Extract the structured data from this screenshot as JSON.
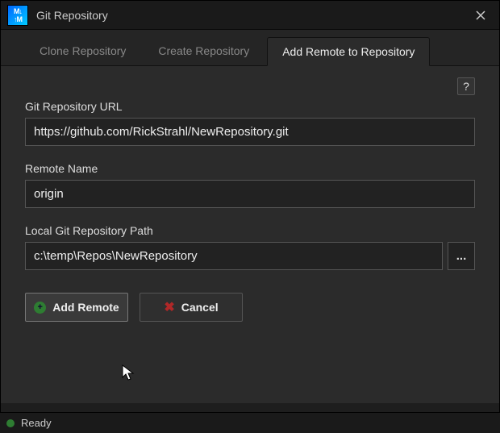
{
  "window": {
    "title": "Git Repository"
  },
  "tabs": {
    "clone": "Clone Repository",
    "create": "Create Repository",
    "addremote": "Add Remote to Repository"
  },
  "form": {
    "url_label": "Git Repository URL",
    "url_value": "https://github.com/RickStrahl/NewRepository.git",
    "remote_label": "Remote Name",
    "remote_value": "origin",
    "path_label": "Local Git Repository Path",
    "path_value": "c:\\temp\\Repos\\NewRepository",
    "browse_label": "..."
  },
  "buttons": {
    "add": "Add Remote",
    "cancel": "Cancel"
  },
  "status": {
    "text": "Ready"
  }
}
